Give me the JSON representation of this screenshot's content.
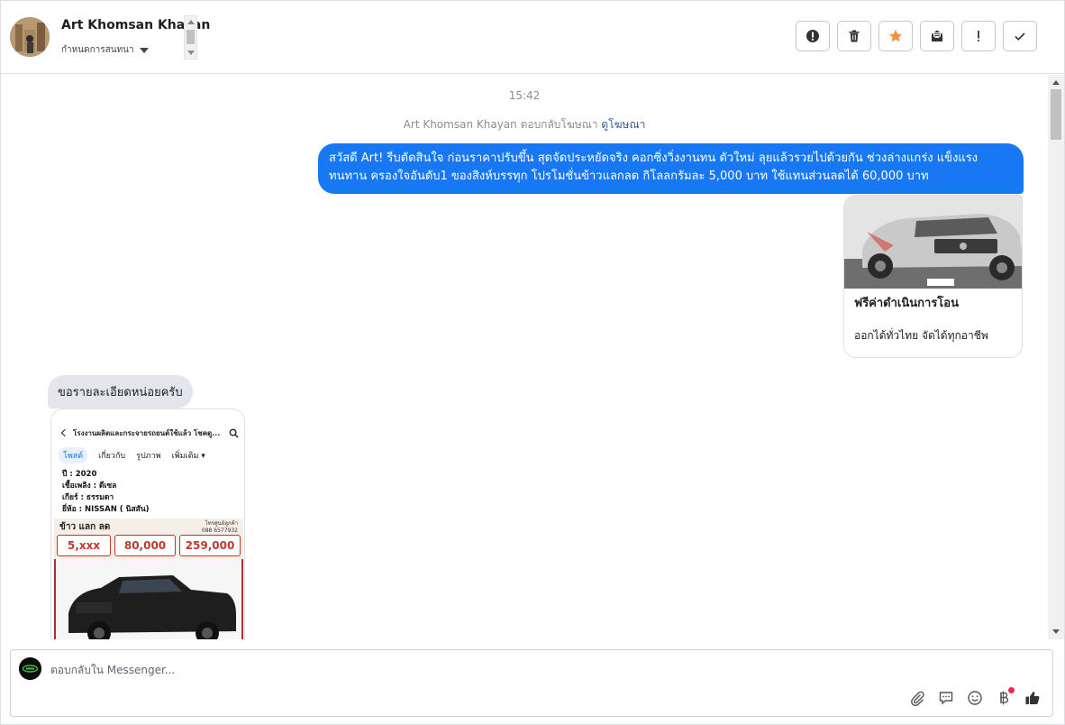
{
  "header": {
    "contact_name": "Art Khomsan Khayan",
    "assign_label": "กำหนดการสนทนา",
    "actions": [
      {
        "name": "report-button",
        "icon": "alert-circle-icon"
      },
      {
        "name": "delete-button",
        "icon": "trash-icon"
      },
      {
        "name": "star-button",
        "icon": "star-icon"
      },
      {
        "name": "mark-unread-button",
        "icon": "envelope-icon"
      },
      {
        "name": "spam-button",
        "icon": "exclamation-icon"
      },
      {
        "name": "mark-done-button",
        "icon": "checkmark-icon"
      }
    ]
  },
  "chat": {
    "timestamp": "15:42",
    "reply_info_text": "Art Khomsan Khayan ตอบกลับโฆษณา",
    "reply_info_link": "ดูโฆษณา",
    "outgoing_message": "สวัสดี Art! รีบตัดสินใจ ก่อนราคาปรับขึ้น สุดจัดประหยัดจริง คอกซิ่งวิ่งงานทน ตัวใหม่ ลุยแล้วรวยไปด้วยกัน ช่วงล่างแกร่ง แข็งแรง ทนทาน ครองใจอันดับ1 ของสิงห์บรรทุก โปรโมชั่นข้าวแลกลด กิโลลกรัมละ 5,000 บาท ใช้แทนส่วนลดได้ 60,000 บาท",
    "ad_card": {
      "title": "ฟรีค่าดำเนินการโอน",
      "description": "ออกได้ทั่วไทย จัดได้ทุกอาชีพ"
    },
    "incoming_message": "ขอรายละเอียดหน่อยครับ",
    "screenshot": {
      "page_title": "โรงงานผลิตและกระจายรถยนต์ใช้แล้ว โชคดู...",
      "tabs": [
        "โพสต์",
        "เกี่ยวกับ",
        "รูปภาพ",
        "เพิ่มเติม ▾"
      ],
      "specs": [
        "ปี : 2020",
        "เชื้อเพลิง : ดีเซล",
        "เกียร์ : ธรรมดา",
        "ยี่ห้อ : NISSAN ( นิสสัน)"
      ],
      "promo_title": "ข้าว แลก ลด",
      "promo_phone": "โทรศูนย์ลูกค้า\n088 6577932",
      "prices": [
        "5,xxx",
        "80,000",
        "259,000"
      ]
    }
  },
  "composer": {
    "placeholder": "ตอบกลับใน Messenger...",
    "tools": [
      "paperclip-icon",
      "chat-icon",
      "emoji-icon",
      "baht-icon",
      "thumbs-up-icon"
    ]
  },
  "colors": {
    "accent": "#1877f2",
    "star": "#f7923a",
    "badge": "#f02849"
  }
}
